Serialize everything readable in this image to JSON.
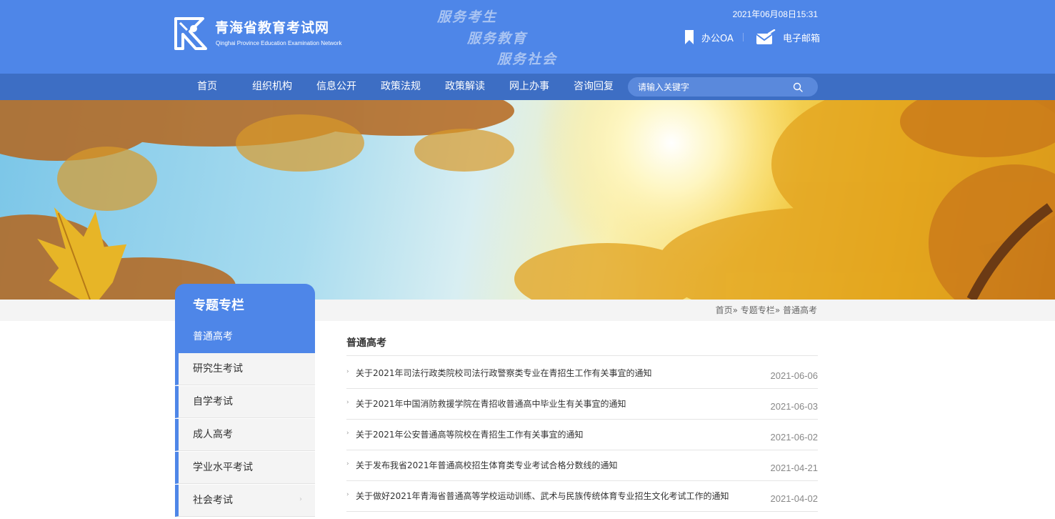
{
  "header": {
    "logo_cn": "青海省教育考试网",
    "logo_en": "Qinghai Province Education Examination Network",
    "slogans": [
      "服务考生",
      "服务教育",
      "服务社会"
    ],
    "datetime": "2021年06月08日15:31",
    "quick_links": [
      {
        "label": "办公OA",
        "icon": "bookmark-icon"
      },
      {
        "label": "电子邮箱",
        "icon": "mail-icon"
      }
    ],
    "colors": {
      "header_bg": "#4e86e8",
      "nav_bg": "#3d6ec4"
    }
  },
  "nav": {
    "items": [
      "首页",
      "组织机构",
      "信息公开",
      "政策法规",
      "政策解读",
      "网上办事",
      "咨询回复"
    ],
    "search_placeholder": "请输入关键字"
  },
  "breadcrumb": {
    "items": [
      "首页",
      "专题专栏",
      "普通高考"
    ],
    "separator": "»"
  },
  "sidebar": {
    "title": "专题专栏",
    "items": [
      {
        "label": "普通高考",
        "active": true
      },
      {
        "label": "研究生考试",
        "active": false
      },
      {
        "label": "自学考试",
        "active": false
      },
      {
        "label": "成人高考",
        "active": false
      },
      {
        "label": "学业水平考试",
        "active": false
      },
      {
        "label": "社会考试",
        "active": false
      }
    ]
  },
  "main": {
    "title": "普通高考",
    "news": [
      {
        "title": "关于2021年司法行政类院校司法行政警察类专业在青招生工作有关事宜的通知",
        "date": "2021-06-06"
      },
      {
        "title": "关于2021年中国消防救援学院在青招收普通高中毕业生有关事宜的通知",
        "date": "2021-06-03"
      },
      {
        "title": "关于2021年公安普通高等院校在青招生工作有关事宜的通知",
        "date": "2021-06-02"
      },
      {
        "title": "关于发布我省2021年普通高校招生体育类专业考试合格分数线的通知",
        "date": "2021-04-21"
      },
      {
        "title": "关于做好2021年青海省普通高等学校运动训练、武术与民族传统体育专业招生文化考试工作的通知",
        "date": "2021-04-02"
      }
    ]
  }
}
